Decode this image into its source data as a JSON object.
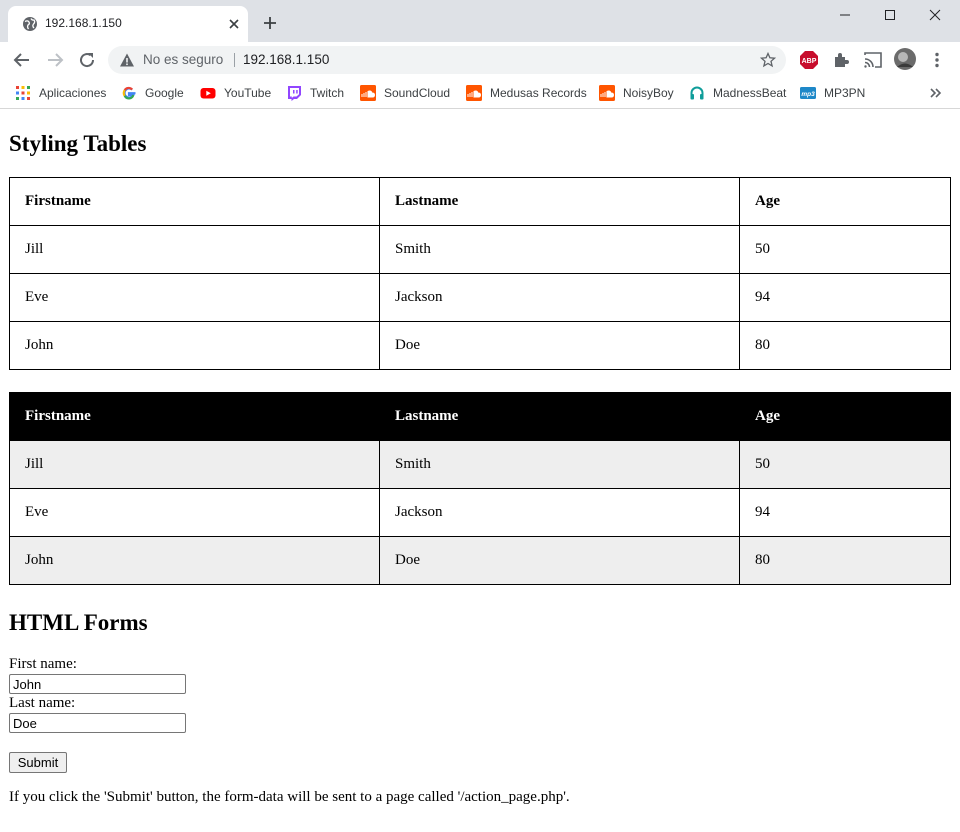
{
  "browser": {
    "tab_title": "192.168.1.150",
    "security_label": "No es seguro",
    "url": "192.168.1.150",
    "bookmarks": [
      {
        "label": "Aplicaciones",
        "icon": "apps-grid-icon"
      },
      {
        "label": "Google",
        "icon": "google-icon"
      },
      {
        "label": "YouTube",
        "icon": "youtube-icon"
      },
      {
        "label": "Twitch",
        "icon": "twitch-icon"
      },
      {
        "label": "SoundCloud",
        "icon": "soundcloud-icon"
      },
      {
        "label": "Medusas Records",
        "icon": "soundcloud-icon"
      },
      {
        "label": "NoisyBoy",
        "icon": "soundcloud-icon"
      },
      {
        "label": "MadnessBeat",
        "icon": "headphones-icon"
      },
      {
        "label": "MP3PN",
        "icon": "mp3-icon"
      }
    ],
    "colors": {
      "tabstrip": "#dee1e6",
      "omnibox": "#f1f3f4",
      "abp": "#c70d2c"
    }
  },
  "page": {
    "title_tables": "Styling Tables",
    "table1": {
      "headers": [
        "Firstname",
        "Lastname",
        "Age"
      ],
      "rows": [
        [
          "Jill",
          "Smith",
          "50"
        ],
        [
          "Eve",
          "Jackson",
          "94"
        ],
        [
          "John",
          "Doe",
          "80"
        ]
      ]
    },
    "table2": {
      "headers": [
        "Firstname",
        "Lastname",
        "Age"
      ],
      "rows": [
        [
          "Jill",
          "Smith",
          "50"
        ],
        [
          "Eve",
          "Jackson",
          "94"
        ],
        [
          "John",
          "Doe",
          "80"
        ]
      ]
    },
    "title_forms": "HTML Forms",
    "form": {
      "first_label": "First name:",
      "first_value": "John",
      "last_label": "Last name:",
      "last_value": "Doe",
      "submit_label": "Submit",
      "note": "If you click the 'Submit' button, the form-data will be sent to a page called '/action_page.php'."
    }
  }
}
